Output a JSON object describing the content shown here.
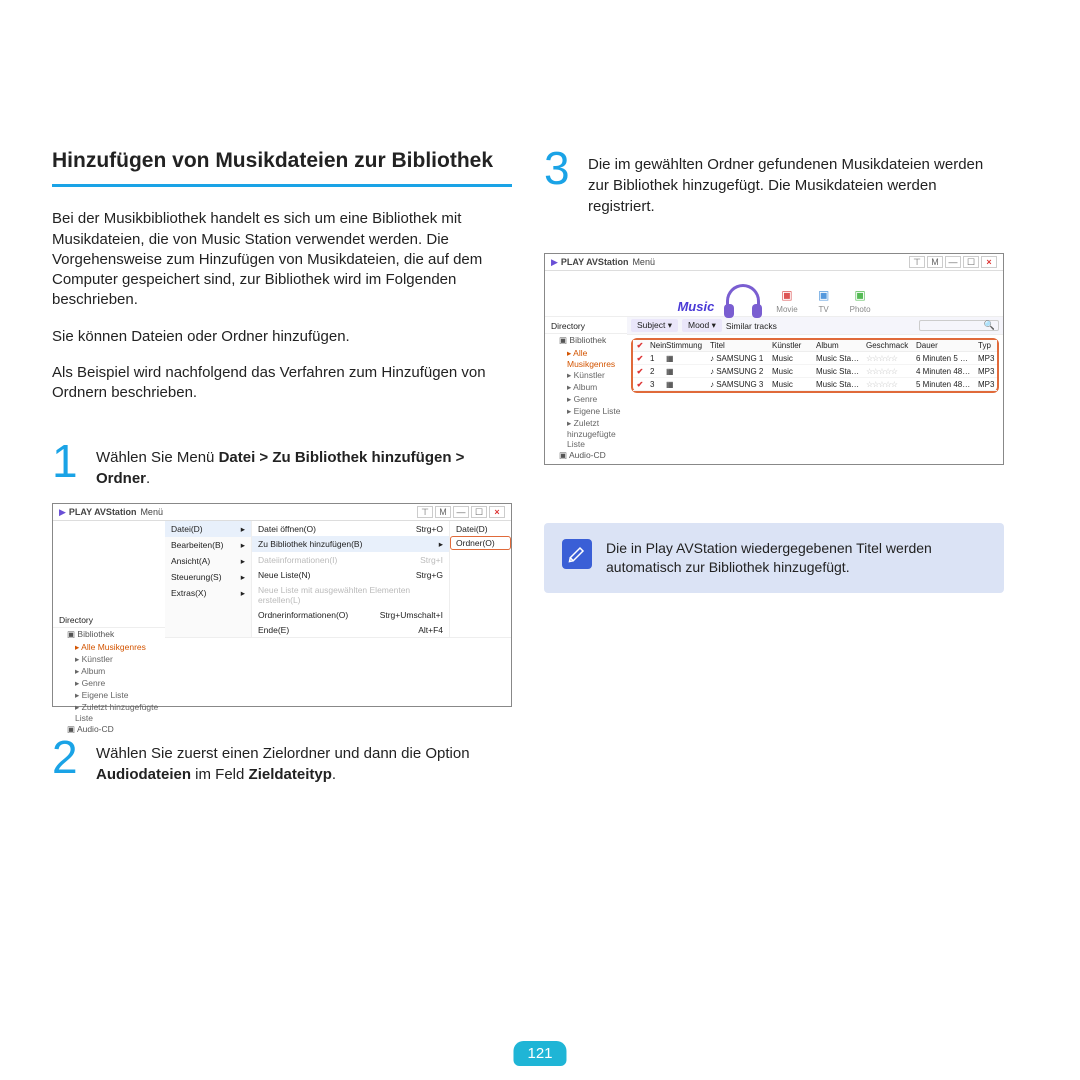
{
  "heading": "Hinzufügen von Musikdateien zur Bibliothek",
  "intro": {
    "p1": "Bei der Musikbibliothek handelt es sich um eine Bibliothek mit Musikdateien, die von Music Station verwendet werden. Die Vorgehensweise zum Hinzufügen von Musikdateien, die auf dem Computer gespeichert sind, zur Bibliothek wird im Folgenden beschrieben.",
    "p2": "Sie können Dateien oder Ordner hinzufügen.",
    "p3": "Als Beispiel wird nachfolgend das Verfahren zum Hinzufügen von Ordnern beschrieben."
  },
  "steps": {
    "s1": {
      "num": "1",
      "pre": "Wählen Sie Menü ",
      "b1": "Datei > Zu Bibliothek hinzufügen > Ordner",
      "post": "."
    },
    "s2": {
      "num": "2",
      "pre": "Wählen Sie zuerst einen Zielordner und dann die Option ",
      "b1": "Audiodateien",
      "mid": " im Feld ",
      "b2": "Zieldateityp",
      "post": "."
    },
    "s3": {
      "num": "3",
      "text": "Die im gewählten Ordner gefundenen Musikdateien werden zur Bibliothek hinzugefügt. Die Musikdateien werden registriert."
    }
  },
  "app": {
    "title": "PLAY AVStation",
    "menuLabel": "Menü",
    "directory": "Directory",
    "tree": {
      "bibliothek": "Bibliothek",
      "alleMusikgenres": "Alle Musikgenres",
      "kunstler": "Künstler",
      "album": "Album",
      "genre": "Genre",
      "eigeneListe": "Eigene Liste",
      "zuletzt": "Zuletzt hinzugefügte Liste",
      "audioCD": "Audio-CD"
    },
    "menu1": {
      "datei": "Datei(D)",
      "bearbeiten": "Bearbeiten(B)",
      "ansicht": "Ansicht(A)",
      "steuerung": "Steuerung(S)",
      "extras": "Extras(X)"
    },
    "menu2": {
      "oeffnen": "Datei öffnen(O)",
      "sc_oeffnen": "Strg+O",
      "zuBib": "Zu Bibliothek hinzufügen(B)",
      "dateiInfo": "Dateiinformationen(I)",
      "sc_dateiInfo": "Strg+I",
      "neueListe": "Neue Liste(N)",
      "sc_neueListe": "Strg+G",
      "neueListeAus": "Neue Liste mit ausgewählten Elementen erstellen(L)",
      "ordnerInfo": "Ordnerinformationen(O)",
      "sc_ordnerInfo": "Strg+Umschalt+I",
      "ende": "Ende(E)",
      "sc_ende": "Alt+F4"
    },
    "menu3": {
      "datei": "Datei(D)",
      "ordner": "Ordner(O)"
    },
    "hero": {
      "music": "Music",
      "movie": "Movie",
      "tv": "TV",
      "photo": "Photo"
    },
    "filters": {
      "subject": "Subject ▾",
      "mood": "Mood ▾",
      "similar": "Similar tracks"
    },
    "listHeaders": {
      "nein": "Nein",
      "stimmung": "Stimmung",
      "titel": "Titel",
      "kunstler": "Künstler",
      "album": "Album",
      "geschmack": "Geschmack",
      "dauer": "Dauer",
      "typ": "Typ"
    },
    "rows": [
      {
        "n": "1",
        "titel": "SAMSUNG 1",
        "kunstler": "Music",
        "album": "Music Sta…",
        "dauer": "6 Minuten 5 …",
        "typ": "MP3"
      },
      {
        "n": "2",
        "titel": "SAMSUNG 2",
        "kunstler": "Music",
        "album": "Music Sta…",
        "dauer": "4 Minuten 48…",
        "typ": "MP3"
      },
      {
        "n": "3",
        "titel": "SAMSUNG 3",
        "kunstler": "Music",
        "album": "Music Sta…",
        "dauer": "5 Minuten 48…",
        "typ": "MP3"
      }
    ]
  },
  "note": "Die in Play AVStation wiedergegebenen Titel werden automatisch zur Bibliothek hinzugefügt.",
  "pageNumber": "121"
}
